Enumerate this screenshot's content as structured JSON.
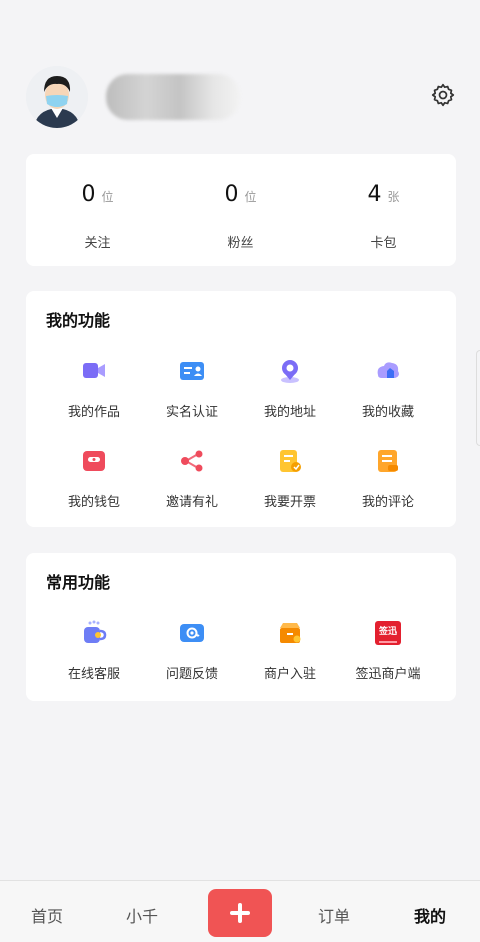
{
  "profile": {
    "icons": {
      "avatar": "user-avatar",
      "settings": "gear-icon"
    }
  },
  "stats": [
    {
      "num": "0",
      "unit": "位",
      "label": "关注"
    },
    {
      "num": "0",
      "unit": "位",
      "label": "粉丝"
    },
    {
      "num": "4",
      "unit": "张",
      "label": "卡包"
    }
  ],
  "my_functions": {
    "title": "我的功能",
    "items": [
      {
        "label": "我的作品",
        "icon": "video-icon"
      },
      {
        "label": "实名认证",
        "icon": "id-card-icon"
      },
      {
        "label": "我的地址",
        "icon": "location-icon"
      },
      {
        "label": "我的收藏",
        "icon": "favorites-icon"
      },
      {
        "label": "我的钱包",
        "icon": "wallet-icon"
      },
      {
        "label": "邀请有礼",
        "icon": "share-icon"
      },
      {
        "label": "我要开票",
        "icon": "invoice-icon"
      },
      {
        "label": "我的评论",
        "icon": "comment-icon"
      }
    ]
  },
  "common_functions": {
    "title": "常用功能",
    "items": [
      {
        "label": "在线客服",
        "icon": "customer-service-icon"
      },
      {
        "label": "问题反馈",
        "icon": "feedback-icon"
      },
      {
        "label": "商户入驻",
        "icon": "merchant-icon"
      },
      {
        "label": "签迅商户端",
        "icon": "qianxun-app-icon",
        "logo_text": "签迅"
      }
    ]
  },
  "tabbar": {
    "tabs": [
      "首页",
      "小千",
      "订单",
      "我的"
    ],
    "active": "我的"
  },
  "colors": {
    "accent": "#f05454",
    "card": "#ffffff",
    "bg": "#f4f4f6"
  }
}
